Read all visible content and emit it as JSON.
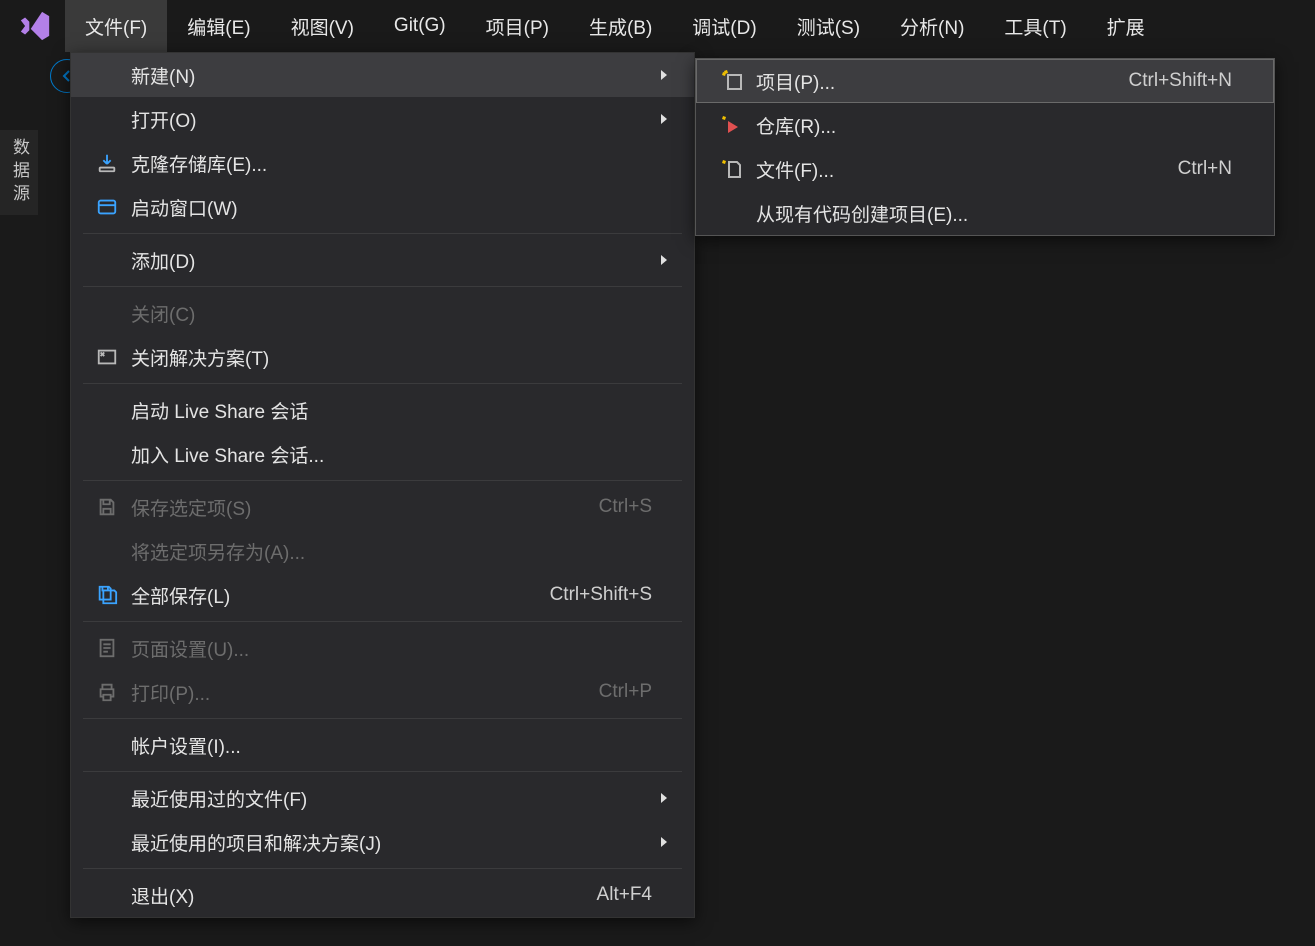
{
  "menubar": {
    "items": [
      {
        "label": "文件(F)"
      },
      {
        "label": "编辑(E)"
      },
      {
        "label": "视图(V)"
      },
      {
        "label": "Git(G)"
      },
      {
        "label": "项目(P)"
      },
      {
        "label": "生成(B)"
      },
      {
        "label": "调试(D)"
      },
      {
        "label": "测试(S)"
      },
      {
        "label": "分析(N)"
      },
      {
        "label": "工具(T)"
      },
      {
        "label": "扩展"
      }
    ]
  },
  "sidebar": {
    "tab_label": "数据源"
  },
  "file_menu": {
    "new_label": "新建(N)",
    "open_label": "打开(O)",
    "clone_label": "克隆存储库(E)...",
    "start_window_label": "启动窗口(W)",
    "add_label": "添加(D)",
    "close_label": "关闭(C)",
    "close_solution_label": "关闭解决方案(T)",
    "start_liveshare_label": "启动 Live Share 会话",
    "join_liveshare_label": "加入 Live Share 会话...",
    "save_selected_label": "保存选定项(S)",
    "save_selected_shortcut": "Ctrl+S",
    "save_as_label": "将选定项另存为(A)...",
    "save_all_label": "全部保存(L)",
    "save_all_shortcut": "Ctrl+Shift+S",
    "page_setup_label": "页面设置(U)...",
    "print_label": "打印(P)...",
    "print_shortcut": "Ctrl+P",
    "account_settings_label": "帐户设置(I)...",
    "recent_files_label": "最近使用过的文件(F)",
    "recent_projects_label": "最近使用的项目和解决方案(J)",
    "exit_label": "退出(X)",
    "exit_shortcut": "Alt+F4"
  },
  "new_menu": {
    "project_label": "项目(P)...",
    "project_shortcut": "Ctrl+Shift+N",
    "repo_label": "仓库(R)...",
    "file_label": "文件(F)...",
    "file_shortcut": "Ctrl+N",
    "from_existing_label": "从现有代码创建项目(E)..."
  }
}
